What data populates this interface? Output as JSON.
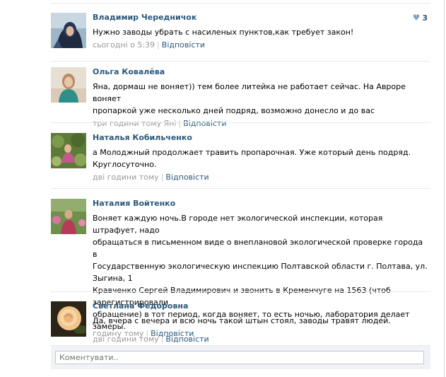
{
  "comments": [
    {
      "author": "Владимир Чередничок",
      "text": "Нужно заводы убрать с насиленых пунктов,как требует закон!",
      "time": "сьогодні о 5:39",
      "reply_label": "Відповісти",
      "likes": "3",
      "avatar_icon": "user-photo-hooded-person"
    },
    {
      "author": "Ольга Ковалёва",
      "text": "Яна, дормаш не воняет)) тем более литейка не работает сейчас. На Авроре воняет\nпропаркой уже несколько дней подряд, возможно донесло и до вас",
      "time": "три години тому Яні",
      "reply_label": "Відповісти",
      "avatar_icon": "user-photo-woman"
    },
    {
      "author": "Наталья Кобильченко",
      "text": "а Молоджный продолжает травить пропарочная. Уже который день подряд.\nКруглосуточно.",
      "time": "дві години тому",
      "reply_label": "Відповісти",
      "avatar_icon": "user-photo-garden"
    },
    {
      "author": "Наталия Войтенко",
      "text": "Воняет каждую ночь.В городе нет экологической инспекции, которая штрафует, надо\nобращаться в письменном виде о внеплановой экологической проверке города в\nГосударственную экологическую инспекцию Полтавской области г. Полтава, ул. Зыгина, 1\nКравченко Сергей Владимирович и звонить в Кременчуге на 1563 (чтоб зарегистрировали\nобращение) в тот период, когда воняет, то есть ночью, лаборатория делает замеры.",
      "time": "дві години тому",
      "reply_label": "Відповісти",
      "avatar_icon": "user-photo-woman-garden"
    },
    {
      "author": "Светлана Федоровна",
      "text": "Да, вчера с вечера и всю ночь такой штын стоял, заводы травят людей.",
      "time": "годину тому",
      "reply_label": "Відповісти",
      "avatar_icon": "user-photo-rose"
    }
  ],
  "reply_box": {
    "placeholder": "Коментувати.."
  },
  "colors": {
    "link": "#2b587a",
    "meta": "#999999",
    "separator": "#e7eaed",
    "reply_bg": "#f0f2f5"
  }
}
